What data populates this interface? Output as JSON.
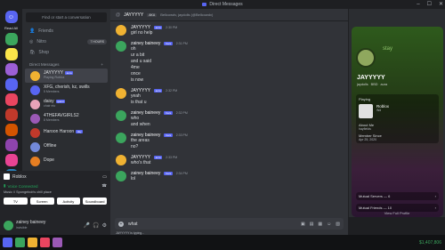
{
  "window": {
    "title": "Direct Messages"
  },
  "servers": {
    "read_all": "Read All"
  },
  "dm_list": {
    "search_placeholder": "Find or start a conversation",
    "nav": [
      {
        "label": "Friends"
      },
      {
        "label": "Nitro",
        "badge": "7 HOURS"
      },
      {
        "label": "Shop"
      }
    ],
    "header": "Direct Messages",
    "items": [
      {
        "name": "JAYYYYY",
        "tag": "aura",
        "sub": "Playing Roblox",
        "color": "#f0b232"
      },
      {
        "name": "XFG, cherish, kz, swills",
        "sub": "5 Members",
        "color": "#5865f2"
      },
      {
        "name": "daisy",
        "tag": "quest",
        "sub": "chair etc",
        "color": "#e8a3b8"
      },
      {
        "name": "4THEFAVGIRLS2",
        "sub": "8 Members",
        "color": "#9b59b6"
      },
      {
        "name": "Haroon Haroon",
        "tag": "day",
        "sub": "",
        "color": "#c0392b"
      },
      {
        "name": "Offline",
        "sub": "",
        "color": "#7289da"
      },
      {
        "name": "Dope",
        "sub": "",
        "color": "#e67e22"
      }
    ]
  },
  "activity": {
    "app": "Roblox",
    "voice_status": "Voice Connected",
    "voice_channel": "Music // Spongebob's chill place",
    "buttons": [
      "TV",
      "Screen",
      "Activity",
      "Soundboard"
    ]
  },
  "user": {
    "name": "zainey baineey",
    "status": "invisible"
  },
  "chat": {
    "recipient": "JAYYYYY",
    "recipient_tag": "AKA",
    "recipient_alt": "Bellcowdv, jaydolls (@Bellcowdv)",
    "messages": [
      {
        "author": "JAYYYYY",
        "tag": "aura",
        "time": "2:30 PM",
        "lines": [
          "girl no help"
        ],
        "color": "#f0b232"
      },
      {
        "author": "zainey baineey",
        "tag": "Cars",
        "time": "2:31 PM",
        "lines": [
          "oh",
          "ur a bit",
          "and u said",
          "4me",
          "once",
          "is now"
        ],
        "color": "#3ba55d"
      },
      {
        "author": "JAYYYYY",
        "tag": "aura",
        "time": "2:32 PM",
        "lines": [
          "yeah",
          "is that u"
        ],
        "color": "#f0b232"
      },
      {
        "author": "zainey baineey",
        "tag": "Cars",
        "time": "2:32 PM",
        "lines": [
          "who",
          "and when"
        ],
        "color": "#3ba55d"
      },
      {
        "author": "zainey baineey",
        "tag": "Cars",
        "time": "2:33 PM",
        "lines": [
          "the areas",
          "no?"
        ],
        "color": "#3ba55d"
      },
      {
        "author": "JAYYYYY",
        "tag": "aura",
        "time": "2:33 PM",
        "lines": [
          "who's that"
        ],
        "color": "#f0b232"
      },
      {
        "author": "zainey baineey",
        "tag": "Cars",
        "time": "2:34 PM",
        "lines": [
          "lol"
        ],
        "color": "#3ba55d"
      }
    ],
    "typing": "JAYYYYY is typing...",
    "input_value": "what"
  },
  "profile": {
    "display_name": "JAYYYYY",
    "username": "jaydolls",
    "tags": [
      "BBD",
      "aura"
    ],
    "playing_label": "Playing",
    "game": "Roblox",
    "game_sub": "Wd",
    "about_label": "About Me",
    "about_text": "hayfields",
    "member_since_label": "Member Since",
    "member_since": "Apr 25, 2020",
    "mutual_servers": "Mutual Servers — 6",
    "mutual_friends": "Mutual Friends — 10",
    "view_full": "View Full Profile",
    "banner_text": "stay"
  },
  "taskbar": {
    "money": "$1,407,806"
  }
}
